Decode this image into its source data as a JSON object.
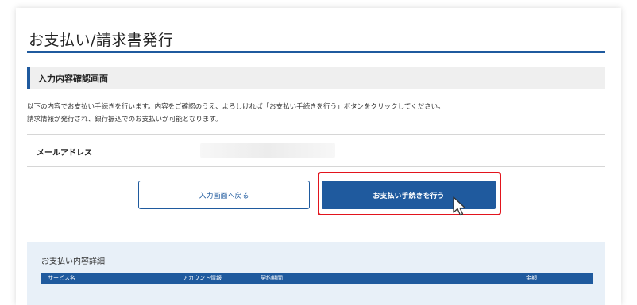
{
  "page": {
    "title": "お支払い/請求書発行"
  },
  "section": {
    "title": "入力内容確認画面"
  },
  "description": {
    "line1": "以下の内容でお支払い手続きを行います。内容をご確認のうえ、よろしければ「お支払い手続きを行う」ボタンをクリックしてください。",
    "line2": "請求情報が発行され、銀行振込でのお支払いが可能となります。"
  },
  "form": {
    "email_label": "メールアドレス"
  },
  "buttons": {
    "back_label": "入力画面へ戻る",
    "pay_label": "お支払い手続きを行う"
  },
  "details": {
    "title": "お支払い内容詳細",
    "columns": [
      "サービス名",
      "アカウント情報",
      "契約期間",
      "金額"
    ]
  },
  "colors": {
    "primary": "#1f5a9e",
    "highlight": "#e2141d",
    "panel": "#e8f0f8"
  }
}
